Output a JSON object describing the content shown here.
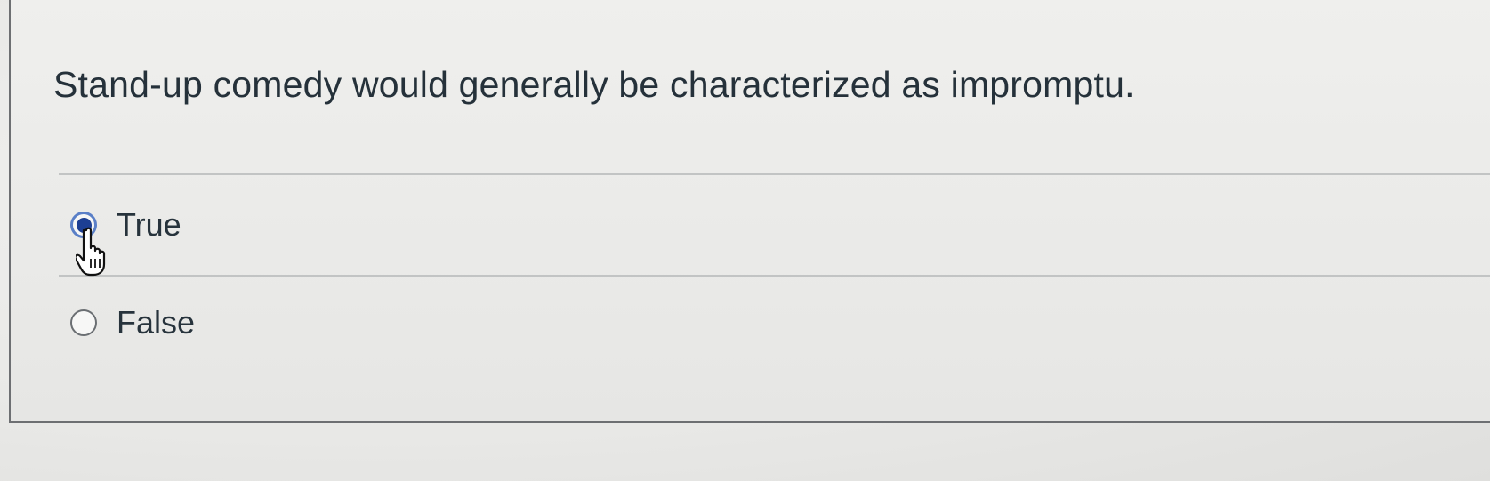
{
  "question": {
    "text": "Stand-up comedy would generally be characterized as impromptu."
  },
  "answers": [
    {
      "label": "True",
      "selected": true
    },
    {
      "label": "False",
      "selected": false
    }
  ],
  "cursor": {
    "icon": "hand-pointer-icon"
  },
  "colors": {
    "radio_selected_fill": "#1d3f93",
    "radio_selected_ring": "#5a7fc7",
    "text": "#25313a",
    "divider": "#c2c4c4"
  }
}
